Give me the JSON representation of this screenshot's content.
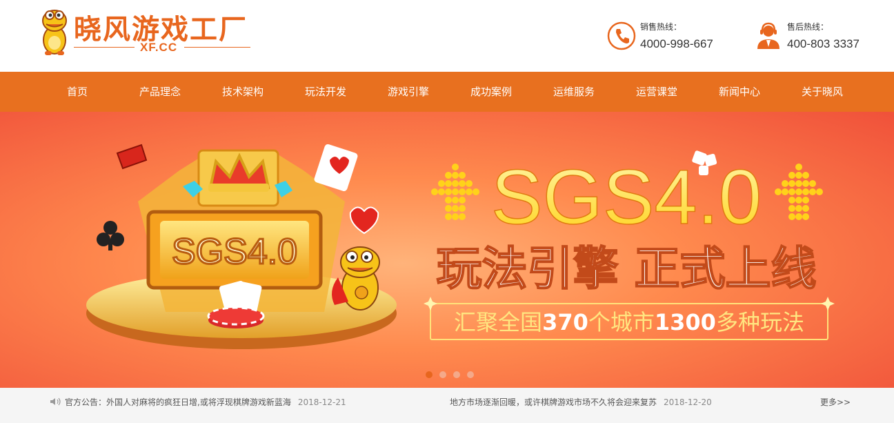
{
  "brand": {
    "name": "晓风游戏工厂",
    "domain": "XF.CC",
    "accent": "#e8661e",
    "nav_color": "#e8701f"
  },
  "hotlines": [
    {
      "label": "销售热线：",
      "number": "4000-998-667",
      "icon": "phone-icon"
    },
    {
      "label": "售后热线：",
      "number": "400-803 3337",
      "icon": "support-agent-icon"
    }
  ],
  "nav": {
    "items": [
      {
        "label": "首页",
        "active": true
      },
      {
        "label": "产品理念"
      },
      {
        "label": "技术架构"
      },
      {
        "label": "玩法开发"
      },
      {
        "label": "游戏引擎"
      },
      {
        "label": "成功案例"
      },
      {
        "label": "运维服务"
      },
      {
        "label": "运营课堂"
      },
      {
        "label": "新闻中心"
      },
      {
        "label": "关于晓风"
      }
    ]
  },
  "banner": {
    "sign_text": "SGS4.0",
    "headline": "SGS4.0",
    "subhead": "玩法引擎 正式上线",
    "tagline_parts": [
      "汇聚全国",
      "370",
      "个城市",
      "1300",
      "多种玩法"
    ],
    "slides": 4,
    "active_slide": 1
  },
  "news": {
    "prefix": "官方公告：",
    "left": {
      "title": "外国人对麻将的疯狂日增,或将浮现棋牌游戏新蓝海",
      "date": "2018-12-21"
    },
    "right": {
      "title": "地方市场逐渐回暖，或许棋牌游戏市场不久将会迎来复苏",
      "date": "2018-12-20"
    },
    "more": "更多>>"
  }
}
